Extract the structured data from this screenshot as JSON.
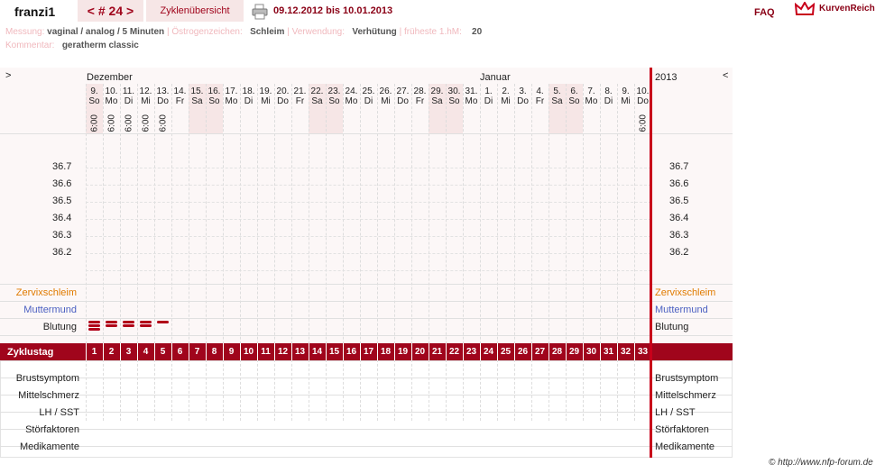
{
  "header": {
    "user": "franzi1",
    "cycle_nav": "< # 24 >",
    "overview_tab": "Zyklenübersicht",
    "print_icon": "printer-icon",
    "date_range": "09.12.2012 bis 10.01.2013",
    "faq": "FAQ",
    "brand": "KurvenReich",
    "brand_icon": "crown-icon"
  },
  "meta": {
    "measurement_label": "Messung:",
    "measurement_value": "vaginal / analog / 5 Minuten",
    "estrogen_label": "Östrogenzeichen:",
    "estrogen_value": "Schleim",
    "usage_label": "Verwendung:",
    "usage_value": "Verhütung",
    "earliest_label": "früheste 1.hM:",
    "earliest_value": "20",
    "comment_label": "Kommentar:",
    "comment_value": "geratherm classic"
  },
  "chart": {
    "nav_left": ">",
    "nav_right": "<",
    "month1": "Dezember",
    "month2": "Januar",
    "year": "2013",
    "days": [
      {
        "d": "9.",
        "w": "So",
        "t": "6:00"
      },
      {
        "d": "10.",
        "w": "Mo",
        "t": "6:00"
      },
      {
        "d": "11.",
        "w": "Di",
        "t": "6:00"
      },
      {
        "d": "12.",
        "w": "Mi",
        "t": "6:00"
      },
      {
        "d": "13.",
        "w": "Do",
        "t": "6:00"
      },
      {
        "d": "14.",
        "w": "Fr",
        "t": ""
      },
      {
        "d": "15.",
        "w": "Sa",
        "t": ""
      },
      {
        "d": "16.",
        "w": "So",
        "t": ""
      },
      {
        "d": "17.",
        "w": "Mo",
        "t": ""
      },
      {
        "d": "18.",
        "w": "Di",
        "t": ""
      },
      {
        "d": "19.",
        "w": "Mi",
        "t": ""
      },
      {
        "d": "20.",
        "w": "Do",
        "t": ""
      },
      {
        "d": "21.",
        "w": "Fr",
        "t": ""
      },
      {
        "d": "22.",
        "w": "Sa",
        "t": ""
      },
      {
        "d": "23.",
        "w": "So",
        "t": ""
      },
      {
        "d": "24.",
        "w": "Mo",
        "t": ""
      },
      {
        "d": "25.",
        "w": "Di",
        "t": ""
      },
      {
        "d": "26.",
        "w": "Mi",
        "t": ""
      },
      {
        "d": "27.",
        "w": "Do",
        "t": ""
      },
      {
        "d": "28.",
        "w": "Fr",
        "t": ""
      },
      {
        "d": "29.",
        "w": "Sa",
        "t": ""
      },
      {
        "d": "30.",
        "w": "So",
        "t": ""
      },
      {
        "d": "31.",
        "w": "Mo",
        "t": ""
      },
      {
        "d": "1.",
        "w": "Di",
        "t": ""
      },
      {
        "d": "2.",
        "w": "Mi",
        "t": ""
      },
      {
        "d": "3.",
        "w": "Do",
        "t": ""
      },
      {
        "d": "4.",
        "w": "Fr",
        "t": ""
      },
      {
        "d": "5.",
        "w": "Sa",
        "t": ""
      },
      {
        "d": "6.",
        "w": "So",
        "t": ""
      },
      {
        "d": "7.",
        "w": "Mo",
        "t": ""
      },
      {
        "d": "8.",
        "w": "Di",
        "t": ""
      },
      {
        "d": "9.",
        "w": "Mi",
        "t": ""
      },
      {
        "d": "10.",
        "w": "Do",
        "t": "6:00"
      }
    ],
    "temps": [
      "36.7",
      "36.6",
      "36.5",
      "36.4",
      "36.3",
      "36.2"
    ],
    "rows_upper": [
      {
        "label": "Zervixschleim",
        "color": "#e07b00"
      },
      {
        "label": "Muttermund",
        "color": "#4a5fc1"
      },
      {
        "label": "Blutung",
        "color": "#222"
      }
    ],
    "bleeding": [
      3,
      2,
      2,
      2,
      1
    ],
    "cycle_label": "Zyklustag",
    "cycle_days": [
      "1",
      "2",
      "3",
      "4",
      "5",
      "6",
      "7",
      "8",
      "9",
      "10",
      "11",
      "12",
      "13",
      "14",
      "15",
      "16",
      "17",
      "18",
      "19",
      "20",
      "21",
      "22",
      "23",
      "24",
      "25",
      "26",
      "27",
      "28",
      "29",
      "30",
      "31",
      "32",
      "33"
    ],
    "rows_lower": [
      "Brustsymptom",
      "Mittelschmerz",
      "LH / SST",
      "Störfaktoren",
      "Medikamente"
    ]
  },
  "footer": {
    "copyright": "© http://www.nfp-forum.de"
  },
  "colors": {
    "accent": "#a0051c",
    "weekend": "#f6e6e6",
    "today_line": "#c8001a"
  }
}
